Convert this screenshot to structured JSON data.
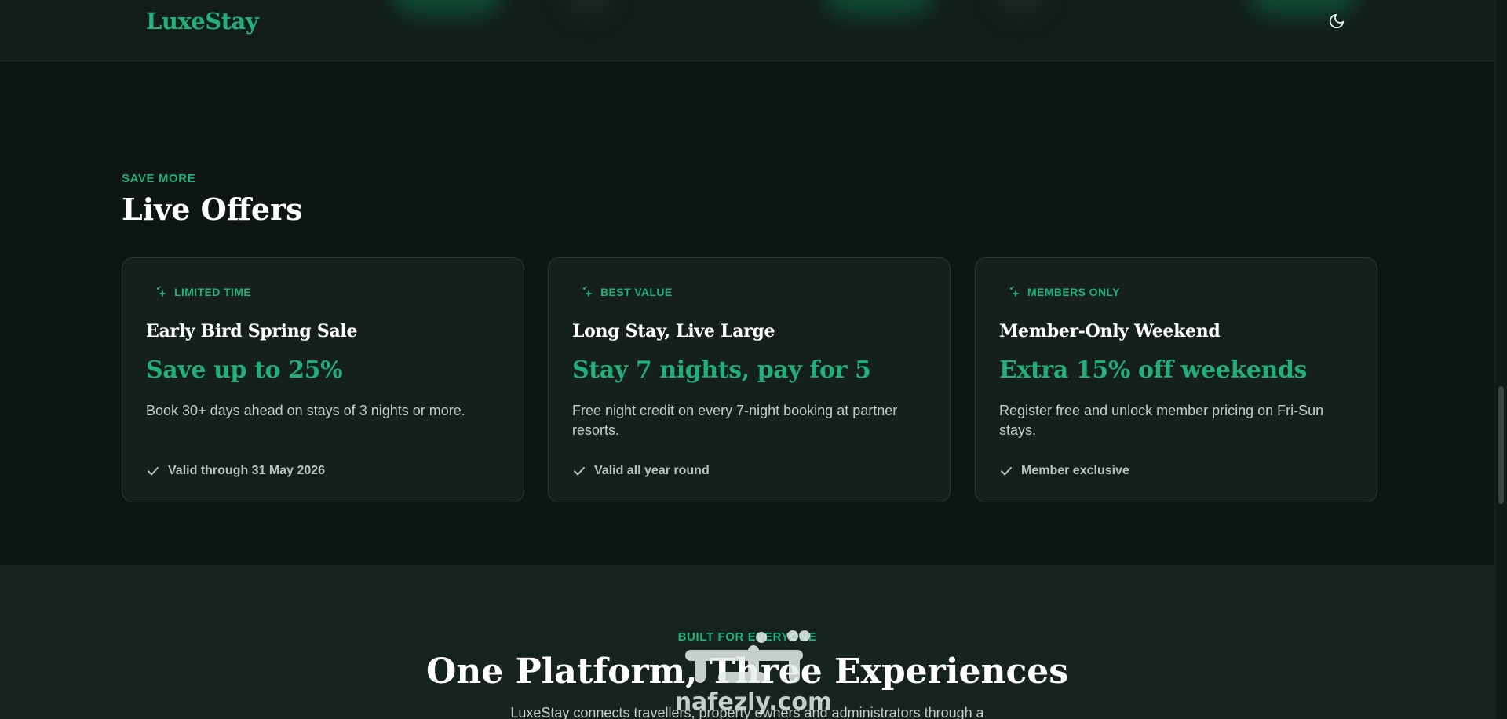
{
  "header": {
    "logo": "LuxeStay",
    "theme_toggle_icon": "moon-icon"
  },
  "offers": {
    "eyebrow": "SAVE MORE",
    "title": "Live Offers",
    "cards": [
      {
        "badge": "LIMITED TIME",
        "badge_icon": "sparkles-icon",
        "title": "Early Bird Spring Sale",
        "offer": "Save up to 25%",
        "description": "Book 30+ days ahead on stays of 3 nights or more.",
        "footnote": "Valid through 31 May 2026",
        "footnote_icon": "check-icon"
      },
      {
        "badge": "BEST VALUE",
        "badge_icon": "sparkles-icon",
        "title": "Long Stay, Live Large",
        "offer": "Stay 7 nights, pay for 5",
        "description": "Free night credit on every 7-night booking at partner resorts.",
        "footnote": "Valid all year round",
        "footnote_icon": "check-icon"
      },
      {
        "badge": "MEMBERS ONLY",
        "badge_icon": "sparkles-icon",
        "title": "Member-Only Weekend",
        "offer": "Extra 15% off weekends",
        "description": "Register free and unlock member pricing on Fri-Sun stays.",
        "footnote": "Member exclusive",
        "footnote_icon": "check-icon"
      }
    ]
  },
  "platform": {
    "eyebrow": "BUILT FOR EVERYONE",
    "title": "One Platform, Three Experiences",
    "subtitle": "LuxeStay connects travellers, property owners and administrators through a"
  },
  "watermark": {
    "text": "nafezly.com"
  },
  "colors": {
    "accent": "#22b07a",
    "background": "#0e1614",
    "card": "#151f1c",
    "lower_section": "#16231f"
  }
}
